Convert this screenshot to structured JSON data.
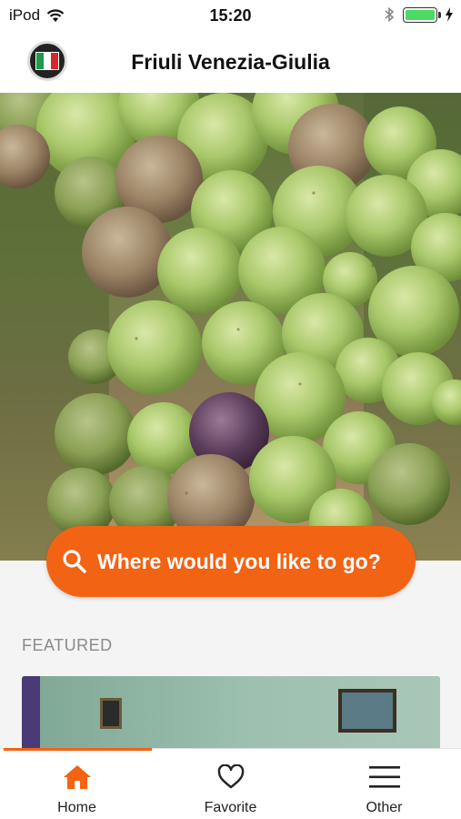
{
  "status_bar": {
    "carrier": "iPod",
    "time": "15:20"
  },
  "header": {
    "title": "Friuli Venezia-Giulia",
    "logo_icon": "italy-flag-logo-icon"
  },
  "search": {
    "placeholder": "Where would you like to go?",
    "icon": "search-icon"
  },
  "featured": {
    "label": "FEATURED"
  },
  "tabs": [
    {
      "label": "Home",
      "icon": "home-icon",
      "active": true
    },
    {
      "label": "Favorite",
      "icon": "heart-icon",
      "active": false
    },
    {
      "label": "Other",
      "icon": "menu-icon",
      "active": false
    }
  ],
  "colors": {
    "accent": "#f26313",
    "battery": "#4cd964"
  }
}
